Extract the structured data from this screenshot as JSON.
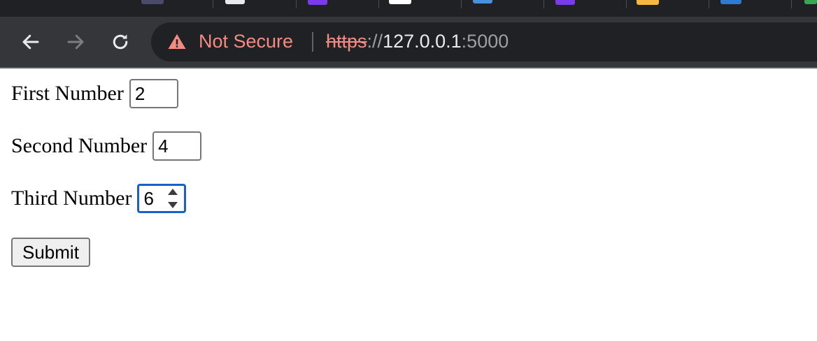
{
  "browser": {
    "security_label": "Not Secure",
    "url": {
      "scheme": "https",
      "separator": "://",
      "host": "127.0.0.1",
      "port": ":5000"
    },
    "colors": {
      "tabstrip": "#202124",
      "toolbar": "#35363a",
      "omnibox": "#202124",
      "insecure": "#f28b82"
    },
    "icons": [
      "back-arrow-icon",
      "forward-arrow-icon",
      "reload-icon",
      "warning-triangle-icon"
    ]
  },
  "form": {
    "fields": [
      {
        "label": "First Number",
        "value": "2",
        "focused": false
      },
      {
        "label": "Second Number",
        "value": "4",
        "focused": false
      },
      {
        "label": "Third Number",
        "value": "6",
        "focused": true
      }
    ],
    "submit_label": "Submit",
    "focus_color": "#1a5fd0"
  }
}
